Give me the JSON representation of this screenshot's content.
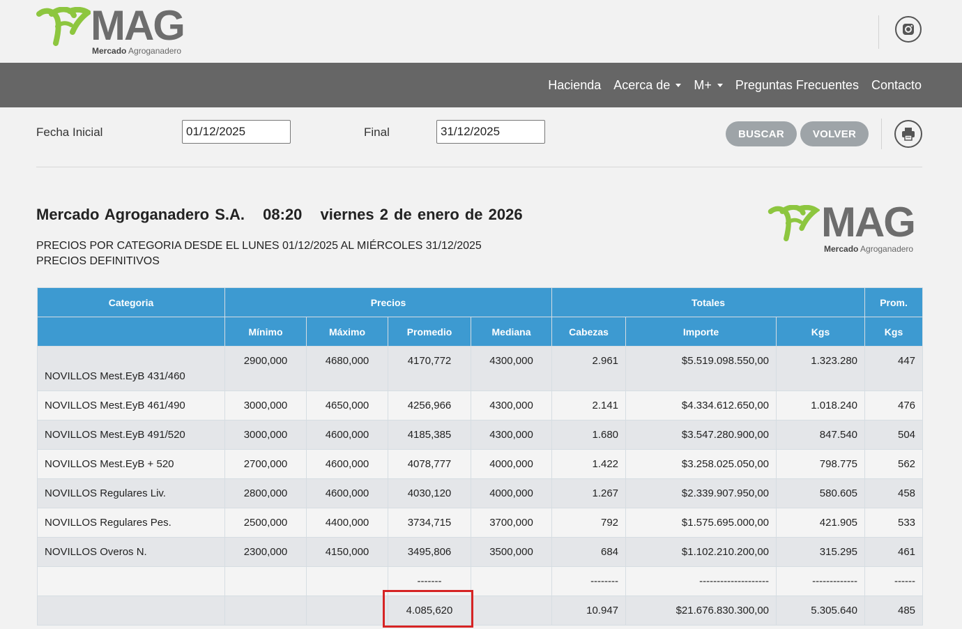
{
  "brand": {
    "name": "MAG",
    "sub_bold": "Mercado",
    "sub_light": "Agroganadero",
    "green": "#8dc63f",
    "grey": "#6d6d6d"
  },
  "nav": {
    "items": [
      {
        "label": "Hacienda",
        "dropdown": false
      },
      {
        "label": "Acerca de",
        "dropdown": true
      },
      {
        "label": "M+",
        "dropdown": true
      },
      {
        "label": "Preguntas Frecuentes",
        "dropdown": false
      },
      {
        "label": "Contacto",
        "dropdown": false
      }
    ],
    "bg_color": "#666666"
  },
  "filters": {
    "start_label": "Fecha Inicial",
    "start_value": "01/12/2025",
    "end_label": "Final",
    "end_value": "31/12/2025",
    "search_button": "BUSCAR",
    "back_button": "VOLVER"
  },
  "report": {
    "company": "Mercado Agroganadero S.A.",
    "time": "08:20",
    "date": "viernes 2 de enero de 2026",
    "line1": "PRECIOS POR CATEGORIA DESDE EL LUNES 01/12/2025 AL MIÉRCOLES 31/12/2025",
    "line2": "PRECIOS DEFINITIVOS"
  },
  "table": {
    "group_headers": {
      "categoria": "Categoria",
      "precios": "Precios",
      "totales": "Totales",
      "prom": "Prom."
    },
    "sub_headers": {
      "minimo": "Mínimo",
      "maximo": "Máximo",
      "promedio": "Promedio",
      "mediana": "Mediana",
      "cabezas": "Cabezas",
      "importe": "Importe",
      "kgs": "Kgs",
      "prom_kgs": "Kgs"
    },
    "header_color": "#3d9ad1",
    "rows": [
      [
        "NOVILLOS Mest.EyB 431/460",
        "2900,000",
        "4680,000",
        "4170,772",
        "4300,000",
        "2.961",
        "$5.519.098.550,00",
        "1.323.280",
        "447"
      ],
      [
        "NOVILLOS Mest.EyB 461/490",
        "3000,000",
        "4650,000",
        "4256,966",
        "4300,000",
        "2.141",
        "$4.334.612.650,00",
        "1.018.240",
        "476"
      ],
      [
        "NOVILLOS Mest.EyB 491/520",
        "3000,000",
        "4600,000",
        "4185,385",
        "4300,000",
        "1.680",
        "$3.547.280.900,00",
        "847.540",
        "504"
      ],
      [
        "NOVILLOS Mest.EyB + 520",
        "2700,000",
        "4600,000",
        "4078,777",
        "4000,000",
        "1.422",
        "$3.258.025.050,00",
        "798.775",
        "562"
      ],
      [
        "NOVILLOS Regulares Liv.",
        "2800,000",
        "4600,000",
        "4030,120",
        "4000,000",
        "1.267",
        "$2.339.907.950,00",
        "580.605",
        "458"
      ],
      [
        "NOVILLOS Regulares Pes.",
        "2500,000",
        "4400,000",
        "3734,715",
        "3700,000",
        "792",
        "$1.575.695.000,00",
        "421.905",
        "533"
      ],
      [
        "NOVILLOS Overos N.",
        "2300,000",
        "4150,000",
        "3495,806",
        "3500,000",
        "684",
        "$1.102.210.200,00",
        "315.295",
        "461"
      ]
    ],
    "separator": [
      "",
      "",
      "",
      "-------",
      "",
      "--------",
      "--------------------",
      "-------------",
      "------"
    ],
    "totals": [
      "",
      "",
      "",
      "4.085,620",
      "",
      "10.947",
      "$21.676.830.300,00",
      "5.305.640",
      "485"
    ]
  },
  "highlight_color": "#d62424"
}
